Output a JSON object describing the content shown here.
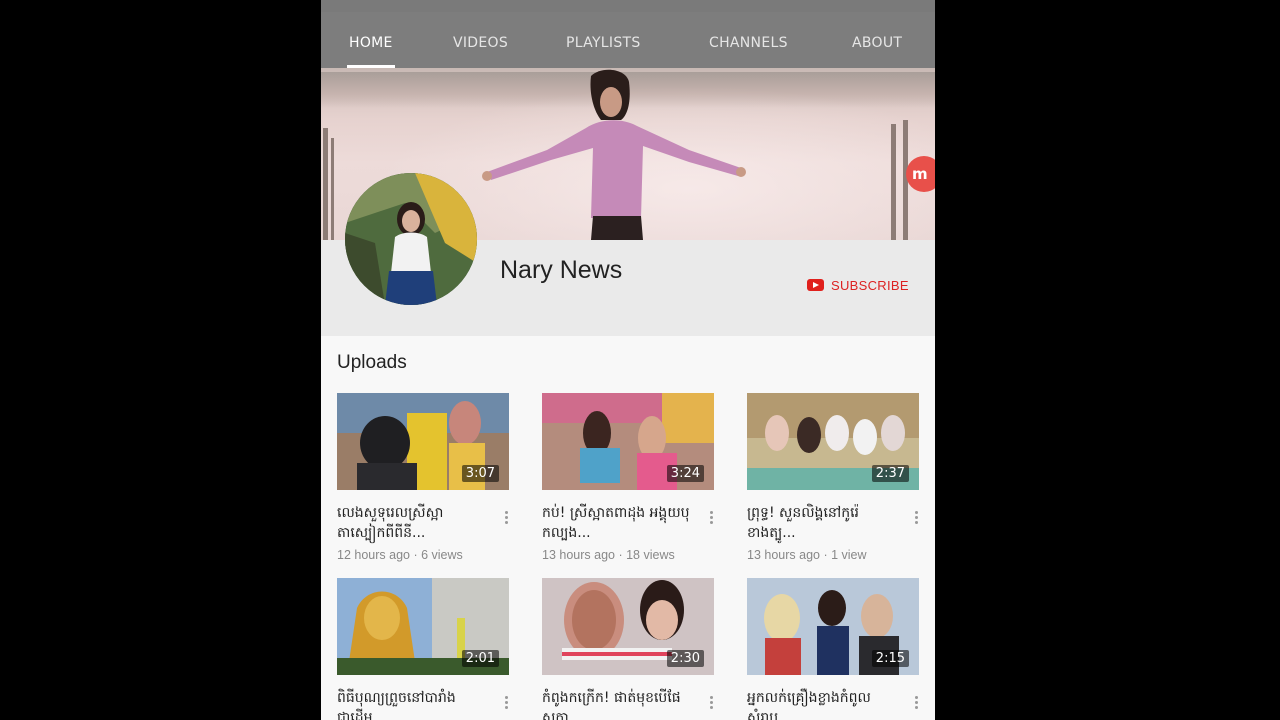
{
  "tabs": [
    {
      "label": "HOME"
    },
    {
      "label": "VIDEOS"
    },
    {
      "label": "PLAYLISTS"
    },
    {
      "label": "CHANNELS"
    },
    {
      "label": "ABOUT"
    }
  ],
  "active_tab": "HOME",
  "channel": {
    "name": "Nary News",
    "subscribe_label": "SUBSCRIBE"
  },
  "uploads": {
    "title": "Uploads",
    "videos": [
      {
        "title": "លេងសួទុរេលស្រីស្អា តាស្បៀកពីពីនី...",
        "meta": "12 hours ago · 6 views",
        "duration": "3:07"
      },
      {
        "title": "កប់! ស្រីស្អាតពាដុង អង្គុយបុកល្បង...",
        "meta": "13 hours ago · 18 views",
        "duration": "3:24"
      },
      {
        "title": "ព្រុទ្ធ! សួនលិង្គនៅកូរ៉េខាងត្បូ...",
        "meta": "13 hours ago · 1 view",
        "duration": "2:37"
      },
      {
        "title": "ពិធីបុណ្យព្រួចនៅបារាំង ជាដើម...",
        "meta": "",
        "duration": "2:01"
      },
      {
        "title": "កំពូងកក្រើក! ផាត់មុខបើផែសក្កា...",
        "meta": "",
        "duration": "2:30"
      },
      {
        "title": "អ្នកលក់គ្រឿងខ្លាងកំពូលសំរាប...",
        "meta": "",
        "duration": "2:15"
      }
    ]
  },
  "colors": {
    "tab_bar": "#7d7d7d",
    "subscribe_red": "#e0201c"
  }
}
